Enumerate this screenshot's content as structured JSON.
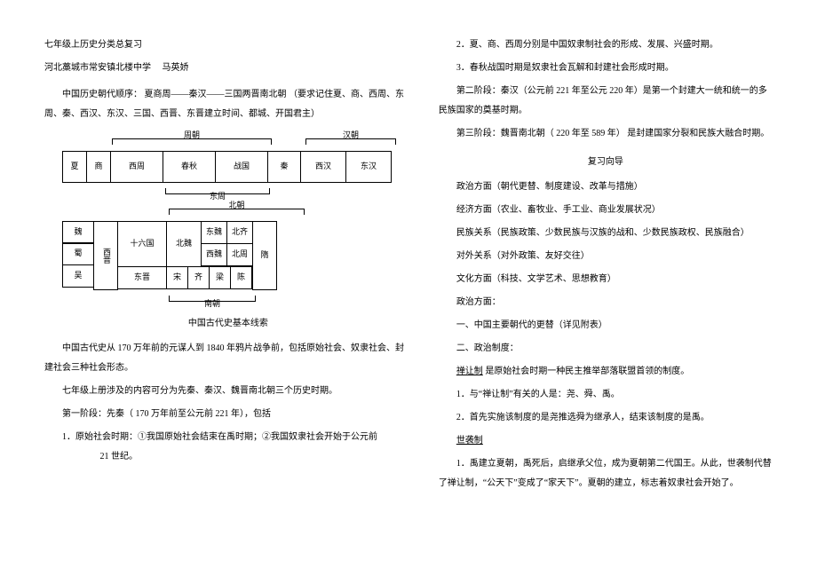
{
  "header": {
    "line1": "七年级上历史分类总复习",
    "line2_school": "河北藁城市常安镇北楼中学",
    "line2_author": "马英娇"
  },
  "intro": {
    "p1": "中国历史朝代顺序：  夏商周——秦汉——三国两晋南北朝  （要求记住夏、商、西周、东周、秦、西汉、东汉、三国、西晋、东晋建立时间、都城、开国君主）"
  },
  "diagram1": {
    "brace_top_left": "周朝",
    "brace_top_right": "汉朝",
    "cells": [
      "夏",
      "商",
      "西周",
      "春秋",
      "战国",
      "秦",
      "西汉",
      "东汉"
    ],
    "brace_bot": "东周"
  },
  "diagram2": {
    "brace_top": "北朝",
    "rows": {
      "r1c1": "魏",
      "r2c1": "蜀",
      "r3c1": "吴",
      "xijin": "西晋",
      "shiliu": "十六国",
      "dongjin": "东晋",
      "beiwej": "北魏",
      "dongwei": "东魏",
      "xiwei": "西魏",
      "beiqi": "北齐",
      "beizhou": "北周",
      "song": "宋",
      "qi": "齐",
      "liang": "梁",
      "chen": "陈",
      "sui": "隋"
    },
    "brace_bot": "南朝"
  },
  "subtitle": "中国古代史基本线索",
  "left_ps": {
    "p2": "中国古代史从  170 万年前的元谋人到  1840 年鸦片战争前，包括原始社会、奴隶社会、封建社会三种社会形态。",
    "p3": "七年级上册涉及的内容可分为先秦、秦汉、魏晋南北朝三个历史时期。",
    "p4": "第一阶段：先秦（  170 万年前至公元前  221 年），包括",
    "p5_a": "1．原始社会时期：①我国原始社会结束在禹时期；②我国奴隶社会开始于公元前",
    "p5_b": "21 世纪。"
  },
  "right_ps": {
    "r1": "2．夏、商、西周分别是中国奴隶制社会的形成、发展、兴盛时期。",
    "r2": "3．春秋战国时期是奴隶社会瓦解和封建社会形成时期。",
    "r3": "第二阶段：秦汉（公元前  221 年至公元  220 年）是第一个封建大一统和统一的多民族国家的奠基时期。",
    "r4": "第三阶段：魏晋南北朝（  220 年至  589 年）  是封建国家分裂和民族大融合时期。",
    "guide_title": "复习向导",
    "g1": "政治方面（朝代更替、制度建设、改革与措施）",
    "g2": "经济方面（农业、畜牧业、手工业、商业发展状况）",
    "g3": "民族关系（民族政策、少数民族与汉族的战和、少数民族政权、民族融合）",
    "g4": "对外关系（对外政策、友好交往）",
    "g5": "文化方面（科技、文学艺术、思想教育）",
    "sec1": "政治方面：",
    "sec2": "一、中国主要朝代的更替（详见附表）",
    "sec3": "二、政治制度：",
    "shanrang_label": "禅让制",
    "shanrang_text": " 是原始社会时期一种民主推举部落联盟首领的制度。",
    "sr1": "1．与“禅让制”有关的人是：尧、舜、禹。",
    "sr2": "2．首先实施该制度的是尧推选舜为继承人，结束该制度的是禹。",
    "shixi_label": "世袭制",
    "sx1": "1．禹建立夏朝，禹死后，启继承父位，成为夏朝第二代国王。从此，世袭制代替了禅让制，“公天下”变成了“家天下”。夏朝的建立，标志着奴隶社会开始了。"
  }
}
